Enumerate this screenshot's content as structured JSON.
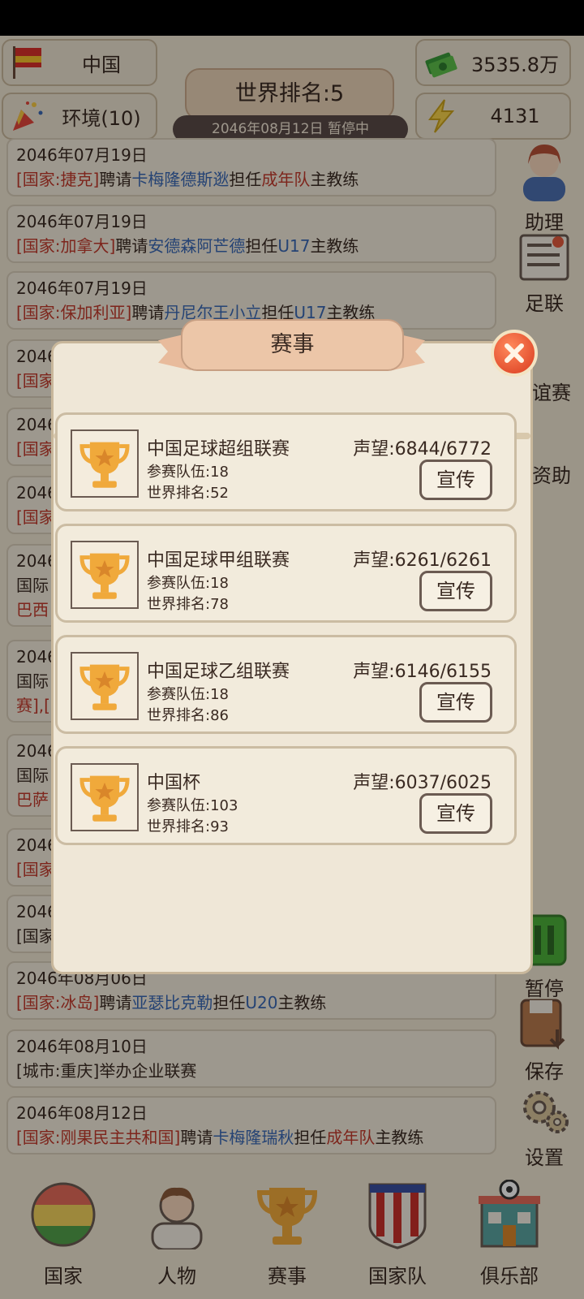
{
  "top": {
    "country": "中国",
    "environment": "环境(10)",
    "world_rank": "世界排名:5",
    "date_status": "2046年08月12日 暂停中",
    "money": "3535.8万",
    "energy": "4131"
  },
  "news": [
    {
      "date": "2046年07月19日",
      "parts": [
        [
          "red",
          "[国家:捷克]"
        ],
        [
          "",
          "聘请"
        ],
        [
          "blue",
          "卡梅隆德斯逖"
        ],
        [
          "",
          "担任"
        ],
        [
          "red",
          "成年队"
        ],
        [
          "",
          "主教练"
        ]
      ]
    },
    {
      "date": "2046年07月19日",
      "parts": [
        [
          "red",
          "[国家:加拿大]"
        ],
        [
          "",
          "聘请"
        ],
        [
          "blue",
          "安德森阿芒德"
        ],
        [
          "",
          "担任"
        ],
        [
          "blue",
          "U17"
        ],
        [
          "",
          "主教练"
        ]
      ]
    },
    {
      "date": "2046年07月19日",
      "parts": [
        [
          "red",
          "[国家:保加利亚]"
        ],
        [
          "",
          "聘请"
        ],
        [
          "blue",
          "丹尼尔王小立"
        ],
        [
          "",
          "担任"
        ],
        [
          "blue",
          "U17"
        ],
        [
          "",
          "主教练"
        ]
      ]
    },
    {
      "date": "2046",
      "parts": [
        [
          "red",
          "[国家"
        ]
      ]
    },
    {
      "date": "2046",
      "parts": [
        [
          "red",
          "[国家"
        ]
      ]
    },
    {
      "date": "2046",
      "parts": [
        [
          "red",
          "[国家"
        ]
      ]
    },
    {
      "date": "2046",
      "parts": [
        [
          "",
          "国际"
        ]
      ],
      "extra": [
        [
          "red",
          "巴西"
        ]
      ]
    },
    {
      "date": "2046",
      "parts": [
        [
          "",
          "国际"
        ]
      ],
      "extra": [
        [
          "red",
          "赛],["
        ]
      ]
    },
    {
      "date": "2046",
      "parts": [
        [
          "",
          "国际"
        ]
      ],
      "extra": [
        [
          "red",
          "巴萨"
        ]
      ]
    },
    {
      "date": "2046",
      "parts": [
        [
          "red",
          "[国家"
        ]
      ]
    },
    {
      "date": "2046",
      "parts": [
        [
          "",
          "[国家"
        ]
      ]
    },
    {
      "date": "2046年08月06日",
      "parts": [
        [
          "red",
          "[国家:冰岛]"
        ],
        [
          "",
          "聘请"
        ],
        [
          "blue",
          "亚瑟比克勒"
        ],
        [
          "",
          "担任"
        ],
        [
          "blue",
          "U20"
        ],
        [
          "",
          "主教练"
        ]
      ]
    },
    {
      "date": "2046年08月10日",
      "parts": [
        [
          "",
          "[城市:重庆]举办企业联赛"
        ]
      ]
    },
    {
      "date": "2046年08月12日",
      "parts": [
        [
          "red",
          "[国家:刚果民主共和国]"
        ],
        [
          "",
          "聘请"
        ],
        [
          "blue",
          "卡梅隆瑞秋"
        ],
        [
          "",
          "担任"
        ],
        [
          "red",
          "成年队"
        ],
        [
          "",
          "主教练"
        ]
      ]
    }
  ],
  "right_menu": {
    "assistant": "助理",
    "league": "足联",
    "friendly": "谊赛",
    "sponsor": "资助",
    "pause": "暂停",
    "save": "保存",
    "settings": "设置"
  },
  "dialog": {
    "title": "赛事",
    "competitions": [
      {
        "name": "中国足球超组联赛",
        "teams": "参赛队伍:18",
        "rank": "世界排名:52",
        "fame": "声望:6844/6772",
        "button": "宣传"
      },
      {
        "name": "中国足球甲组联赛",
        "teams": "参赛队伍:18",
        "rank": "世界排名:78",
        "fame": "声望:6261/6261",
        "button": "宣传"
      },
      {
        "name": "中国足球乙组联赛",
        "teams": "参赛队伍:18",
        "rank": "世界排名:86",
        "fame": "声望:6146/6155",
        "button": "宣传"
      },
      {
        "name": "中国杯",
        "teams": "参赛队伍:103",
        "rank": "世界排名:93",
        "fame": "声望:6037/6025",
        "button": "宣传"
      }
    ]
  },
  "bottom_nav": {
    "country": "国家",
    "people": "人物",
    "events": "赛事",
    "national_team": "国家队",
    "club": "俱乐部"
  },
  "colors": {
    "accent_red": "#c0392b",
    "accent_blue": "#3a67b2",
    "trophy": "#f0a93b"
  }
}
